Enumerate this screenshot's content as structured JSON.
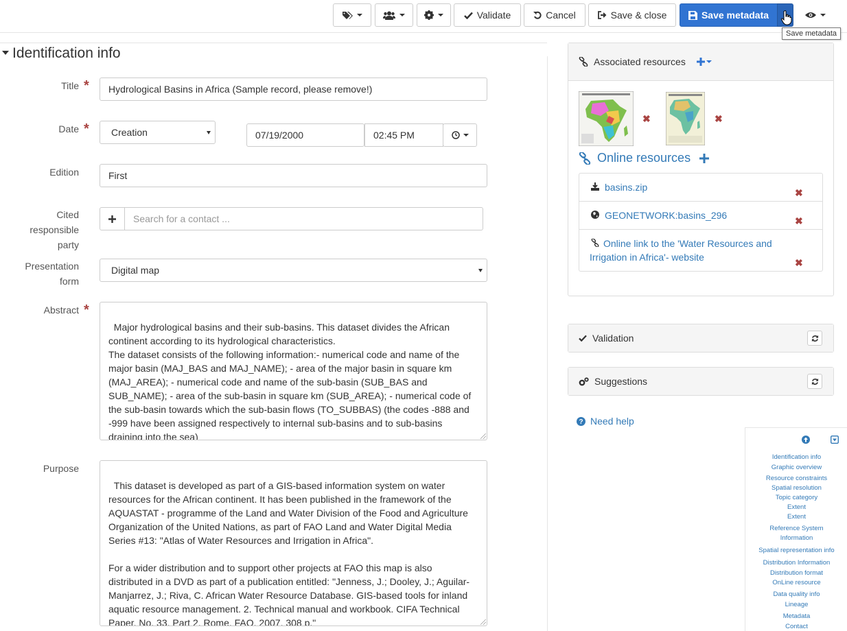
{
  "toolbar": {
    "validate_label": "Validate",
    "cancel_label": "Cancel",
    "save_close_label": "Save & close",
    "save_metadata_label": "Save metadata",
    "tooltip": "Save metadata"
  },
  "section": {
    "title": "Identification info"
  },
  "form": {
    "title_label": "Title",
    "title_value": "Hydrological Basins in Africa (Sample record, please remove!)",
    "date_label": "Date",
    "date_type": "Creation",
    "date_value": "07/19/2000",
    "time_value": "02:45 PM",
    "edition_label": "Edition",
    "edition_value": "First",
    "cited_label_1": "Cited",
    "cited_label_2": "responsible",
    "cited_label_3": "party",
    "contact_placeholder": "Search for a contact ...",
    "presentation_label_1": "Presentation",
    "presentation_label_2": "form",
    "presentation_value": "Digital map",
    "abstract_label": "Abstract",
    "abstract_value": "Major hydrological basins and their sub-basins. This dataset divides the African continent according to its hydrological characteristics.\nThe dataset consists of the following information:- numerical code and name of the major basin (MAJ_BAS and MAJ_NAME); - area of the major basin in square km (MAJ_AREA); - numerical code and name of the sub-basin (SUB_BAS and SUB_NAME); - area of the sub-basin in square km (SUB_AREA); - numerical code of the sub-basin towards which the sub-basin flows (TO_SUBBAS) (the codes -888 and -999 have been assigned respectively to internal sub-basins and to sub-basins draining into the sea)",
    "purpose_label": "Purpose",
    "purpose_value": "This dataset is developed as part of a GIS-based information system on water resources for the African continent. It has been published in the framework of the AQUASTAT - programme of the Land and Water Division of the Food and Agriculture Organization of the United Nations, as part of FAO Land and Water Digital Media Series #13: \"Atlas of Water Resources and Irrigation in Africa\".\n\nFor a wider distribution and to support other projects at FAO this map is also distributed in a DVD as part of a publication entitled: \"Jenness, J.; Dooley, J.; Aguilar-Manjarrez, J.; Riva, C. African Water Resource Database. GIS-based tools for inland aquatic resource management. 2. Technical manual and workbook. CIFA Technical Paper. No. 33, Part 2. Rome, FAO. 2007. 308 p.\""
  },
  "associated": {
    "title": "Associated resources",
    "online_title": "Online resources",
    "online_items": [
      "basins.zip",
      "GEONETWORK:basins_296",
      "Online link to the 'Water Resources and Irrigation in Africa'- website"
    ]
  },
  "validation": {
    "title": "Validation"
  },
  "suggestions": {
    "title": "Suggestions"
  },
  "help": {
    "label": "Need help"
  },
  "toc": [
    "Identification info",
    "Graphic overview",
    "Resource constraints",
    "Spatial resolution",
    "Topic category",
    "Extent",
    "Extent",
    "Reference System",
    "Information",
    "Spatial representation info",
    "Distribution Information",
    "Distribution format",
    "OnLine resource",
    "Data quality info",
    "Lineage",
    "Metadata",
    "Contact"
  ],
  "colors": {
    "primary": "#3174d2",
    "link": "#337ab7",
    "required": "#a94442"
  }
}
